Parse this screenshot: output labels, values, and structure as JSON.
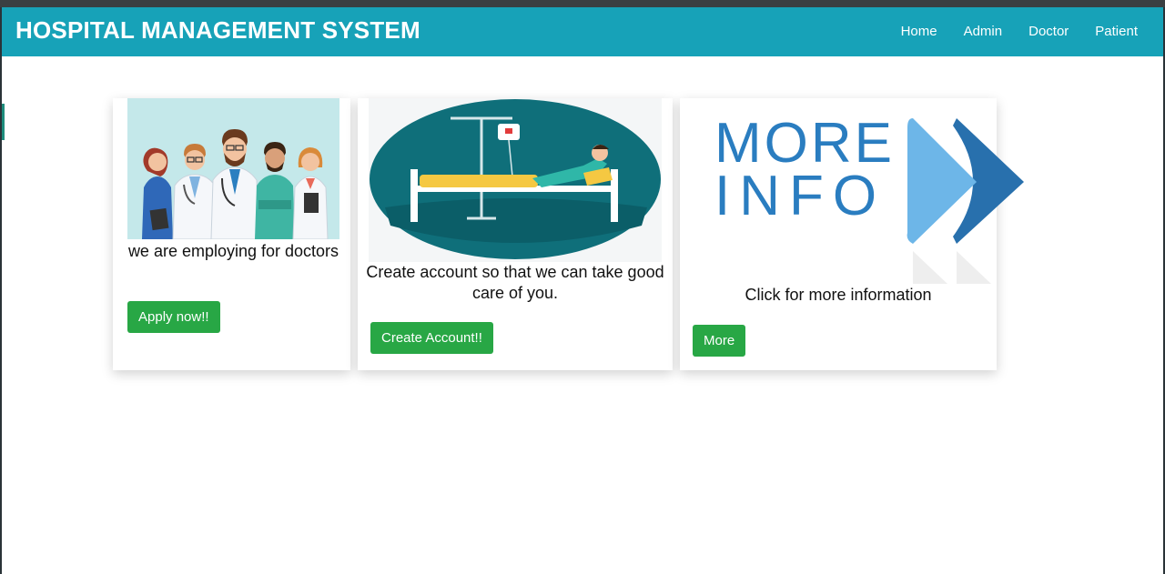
{
  "navbar": {
    "brand": "HOSPITAL MANAGEMENT SYSTEM",
    "links": [
      "Home",
      "Admin",
      "Doctor",
      "Patient"
    ],
    "color": "#17a2b8"
  },
  "cards": [
    {
      "image": "doctors-team-illustration",
      "text": "we are employing for doctors",
      "button": "Apply now!!"
    },
    {
      "image": "patient-in-hospital-bed-illustration",
      "text": "Create account so that we can take good care of you.",
      "button": "Create Account!!"
    },
    {
      "image": "more-info-arrows-graphic",
      "image_text": [
        "MORE",
        "INFO"
      ],
      "text": "Click for more information",
      "button": "More"
    }
  ],
  "colors": {
    "button": "#28a745",
    "info_blue": "#2a7dc0"
  }
}
